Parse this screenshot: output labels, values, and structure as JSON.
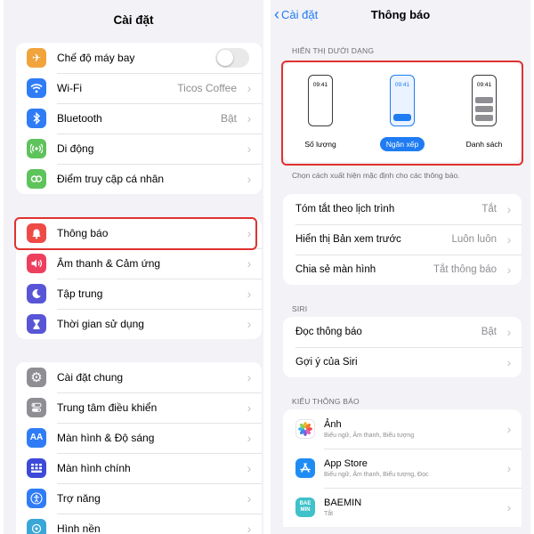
{
  "left": {
    "title": "Cài đặt",
    "group1": [
      {
        "label": "Chế độ máy bay",
        "icon": "airplane-icon",
        "color": "#f1a33c"
      },
      {
        "label": "Wi-Fi",
        "value": "Ticos Coffee",
        "icon": "wifi-icon",
        "color": "#2f7cf6"
      },
      {
        "label": "Bluetooth",
        "value": "Bật",
        "icon": "bluetooth-icon",
        "color": "#2f7cf6"
      },
      {
        "label": "Di động",
        "icon": "cellular-icon",
        "color": "#5fc35b"
      },
      {
        "label": "Điểm truy cập cá nhân",
        "icon": "hotspot-icon",
        "color": "#5fc35b"
      }
    ],
    "group2": [
      {
        "label": "Thông báo",
        "icon": "bell-icon",
        "color": "#ee4a46"
      },
      {
        "label": "Âm thanh & Cảm ứng",
        "icon": "speaker-icon",
        "color": "#ee3f5e"
      },
      {
        "label": "Tập trung",
        "icon": "moon-icon",
        "color": "#5856d6"
      },
      {
        "label": "Thời gian sử dụng",
        "icon": "hourglass-icon",
        "color": "#5856d6"
      }
    ],
    "group3": [
      {
        "label": "Cài đặt chung",
        "icon": "gear-icon",
        "color": "#8e8e93"
      },
      {
        "label": "Trung tâm điều khiển",
        "icon": "switches-icon",
        "color": "#8e8e93"
      },
      {
        "label": "Màn hình & Độ sáng",
        "icon": "text-size-icon",
        "color": "#2f7cf6"
      },
      {
        "label": "Màn hình chính",
        "icon": "home-grid-icon",
        "color": "#3d4ad8"
      },
      {
        "label": "Trợ năng",
        "icon": "accessibility-icon",
        "color": "#2f7cf6"
      },
      {
        "label": "Hình nền",
        "icon": "wallpaper-icon",
        "color": "#38a7d8"
      }
    ]
  },
  "right": {
    "back_label": "Cài đặt",
    "title": "Thông báo",
    "display_header": "HIỂN THỊ DƯỚI DẠNG",
    "phone_time": "09:41",
    "styles": [
      "Số lượng",
      "Ngăn xếp",
      "Danh sách"
    ],
    "selected_style": "Ngăn xếp",
    "display_footer": "Chọn cách xuất hiện mặc định cho các thông báo.",
    "group1": [
      {
        "label": "Tóm tắt theo lịch trình",
        "value": "Tắt"
      },
      {
        "label": "Hiển thị Bản xem trước",
        "value": "Luôn luôn"
      },
      {
        "label": "Chia sẻ màn hình",
        "value": "Tắt thông báo"
      }
    ],
    "siri_header": "SIRI",
    "siri_group": [
      {
        "label": "Đọc thông báo",
        "value": "Bật"
      },
      {
        "label": "Gợi ý của Siri",
        "value": ""
      }
    ],
    "apps_header": "KIỂU THÔNG BÁO",
    "apps": [
      {
        "name": "Ảnh",
        "sub": "Biểu ngữ, Âm thanh, Biểu tượng",
        "icon": "photos-icon"
      },
      {
        "name": "App Store",
        "sub": "Biểu ngữ, Âm thanh, Biểu tượng, Đọc",
        "icon": "app-store-icon",
        "color": "#1f8cf4"
      },
      {
        "name": "BAEMIN",
        "sub": "Tắt",
        "icon": "baemin-icon",
        "color": "#3fc1c9",
        "icon_text": "BAE\nMIN"
      }
    ]
  }
}
